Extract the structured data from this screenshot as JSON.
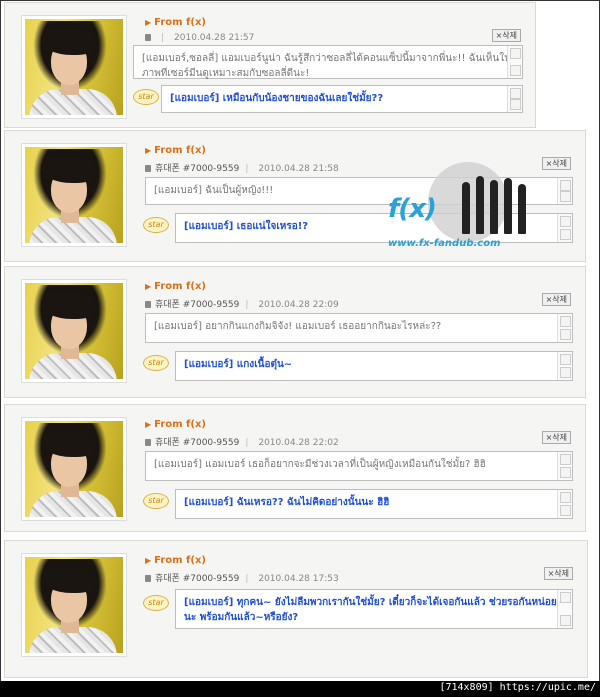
{
  "posts": [
    {
      "from": "From f(x)",
      "user": "",
      "date": "2010.04.28 21:57",
      "delete_label": "×삭제",
      "message": "[แอมเบอร์,ซอลลี่] แอมเบอร์นูน่า ฉันรู้สึกว่าซอลลี่ได้คอนแซ็ปนี้มาจากพี่นะ!! ฉันเห็นในภาพทีเซอร์มีนดูเหมาะสมกับซอลลี่ดีนะ!",
      "reply": "[แอมเบอร์] เหมือนกับน้องชายของฉันเลยใช่มั้ย??",
      "star": "star"
    },
    {
      "from": "From f(x)",
      "user": "휴대폰 #7000-9559",
      "date": "2010.04.28 21:58",
      "delete_label": "×삭제",
      "message": "[แอมเบอร์] ฉันเป็นผู้หญิง!!!",
      "reply": "[แอมเบอร์] เธอแน่ใจเหรอ!?",
      "star": "star"
    },
    {
      "from": "From f(x)",
      "user": "휴대폰 #7000-9559",
      "date": "2010.04.28 22:09",
      "delete_label": "×삭제",
      "message": "[แอมเบอร์] อยากกินแกงกิมจิจัง! แอมเบอร์ เธออยากกินอะไรหล่ะ??",
      "reply": "[แอมเบอร์] แกงเนื้อตุ๋น~",
      "star": "star"
    },
    {
      "from": "From f(x)",
      "user": "휴대폰 #7000-9559",
      "date": "2010.04.28 22:02",
      "delete_label": "×삭제",
      "message": "[แอมเบอร์] แอมเบอร์ เธอก็อยากจะมีช่วงเวลาที่เป็นผู้หญิงเหมือนกันใช่มั้ย? ฮิฮิ",
      "reply": "[แอมเบอร์] ฉันเหรอ?? ฉันไม่คิดอย่างนั้นนะ ฮิฮิ",
      "star": "star"
    },
    {
      "from": "From f(x)",
      "user": "휴대폰 #7000-9559",
      "date": "2010.04.28 17:53",
      "delete_label": "×삭제",
      "message": "",
      "reply": "[แอมเบอร์] ทุกคน~ ยังไม่ลืมพวกเรากันใช่มั้ย? เดี๋ยวก็จะได้เจอกันแล้ว ช่วยรอกันหน่อยนะ พร้อมกันแล้ว~หรือยัง?",
      "star": "star"
    }
  ],
  "watermark": {
    "logo": "f(x)",
    "site": "www.fx-fandub.com"
  },
  "footer": "[714x809] https://upic.me/"
}
